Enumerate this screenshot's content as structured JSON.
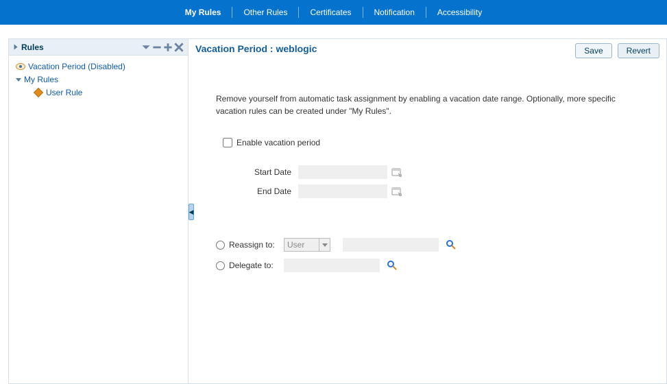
{
  "nav": {
    "items": [
      "My Rules",
      "Other Rules",
      "Certificates",
      "Notification",
      "Accessibility"
    ],
    "active_index": 0
  },
  "sidebar": {
    "title": "Rules",
    "tree": {
      "vacation_label": "Vacation Period (Disabled)",
      "myrules_label": "My Rules",
      "userrule_label": "User Rule"
    }
  },
  "content": {
    "title": "Vacation Period : weblogic",
    "buttons": {
      "save": "Save",
      "revert": "Revert"
    },
    "description": "Remove yourself from automatic task assignment by enabling a vacation date range. Optionally, more specific vacation rules can be created under \"My Rules\".",
    "enable_label": "Enable vacation period",
    "start_label": "Start Date",
    "end_label": "End Date",
    "start_value": "",
    "end_value": "",
    "reassign_label": "Reassign to:",
    "delegate_label": "Delegate to:",
    "user_select": "User",
    "reassign_value": "",
    "delegate_value": ""
  }
}
